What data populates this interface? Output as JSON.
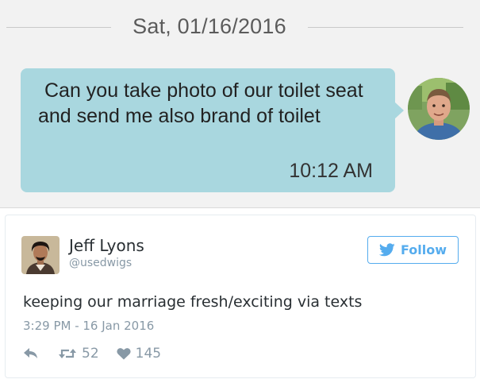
{
  "sms": {
    "date": "Sat, 01/16/2016",
    "message": "Can you take photo of our toilet seat and send me also brand of toilet",
    "time": "10:12 AM",
    "bubble_color": "#a9d7df",
    "sender_avatar_icon": "person-photo-avatar"
  },
  "tweet": {
    "author_name": "Jeff Lyons",
    "author_handle": "@usedwigs",
    "follow_label": "Follow",
    "text": "keeping our marriage fresh/exciting via texts",
    "timestamp": "3:29 PM - 16 Jan 2016",
    "retweet_count": "52",
    "like_count": "145",
    "accent_color": "#55acee",
    "icons": {
      "follow": "twitter-bird-icon",
      "reply": "reply-icon",
      "retweet": "retweet-icon",
      "like": "heart-icon"
    }
  }
}
